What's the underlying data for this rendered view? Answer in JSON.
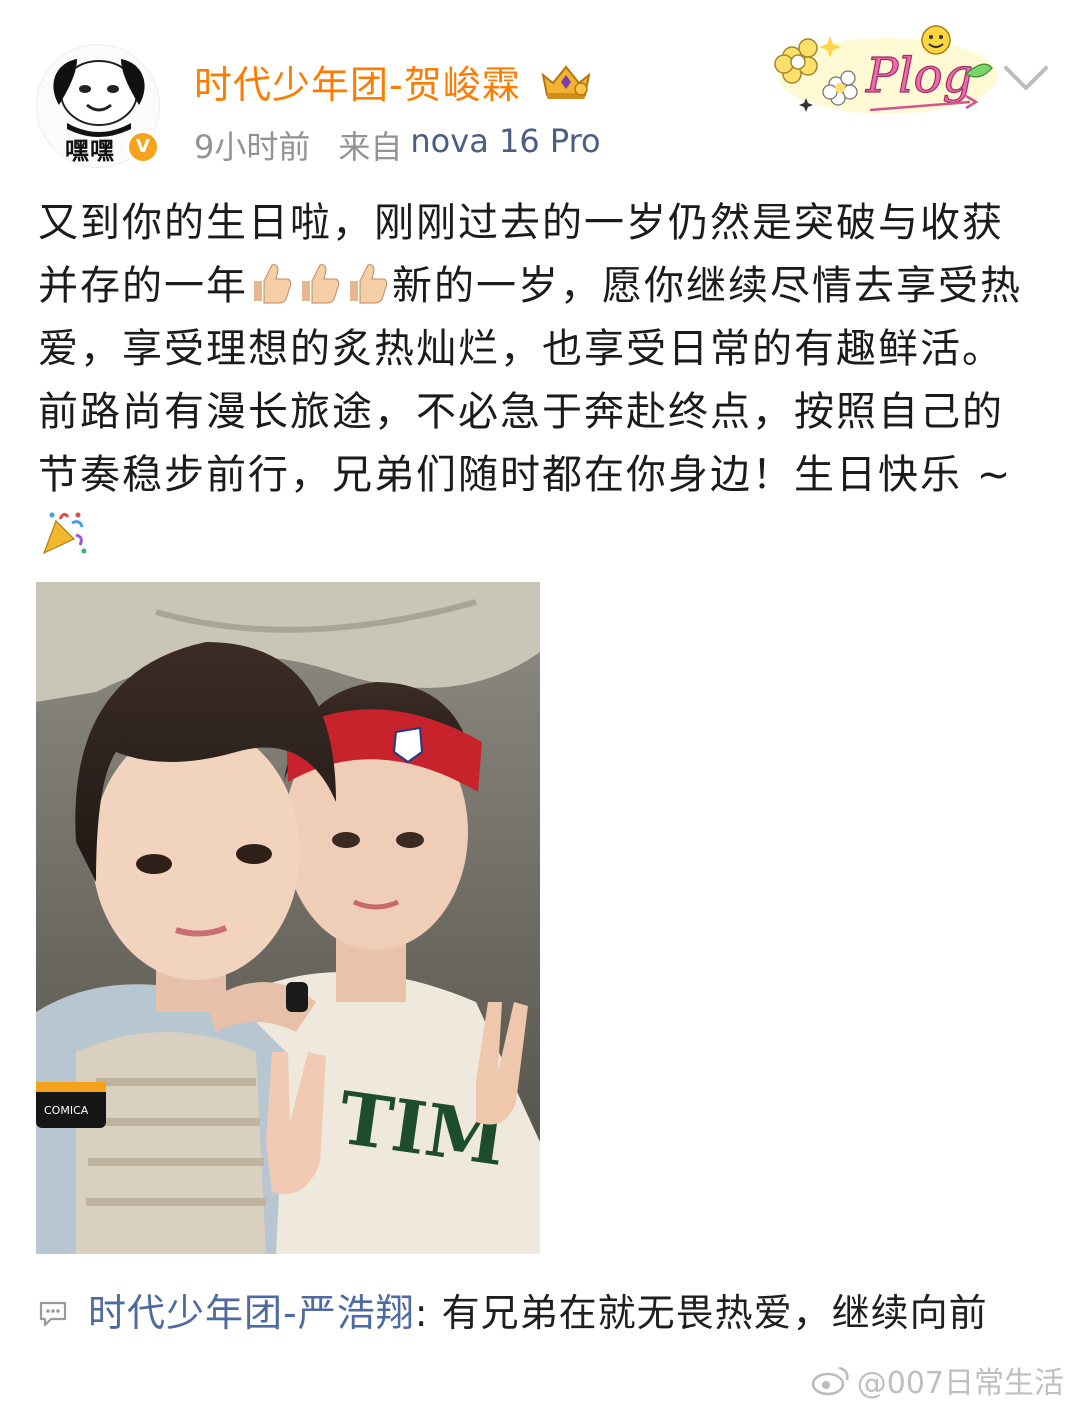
{
  "post": {
    "author": {
      "name": "时代少年团-贺峻霖",
      "avatar_caption": "嘿嘿",
      "verified_badge": "V"
    },
    "time": "9小时前",
    "source_prefix": "来自",
    "source_device": "nova 16 Pro",
    "sticker_text": "Plog",
    "text_segments": [
      "又到你的生日啦，刚刚过去的一岁仍然是突破与收获并存的一年",
      "新的一岁，愿你继续尽情去享受热爱，享受理想的炙热灿烂，也享受日常的有趣鲜活。前路尚有漫长旅途，不必急于奔赴终点，按照自己的节奏稳步前行，兄弟们随时都在你身边！生日快乐 ~ "
    ],
    "photo_texts": {
      "mic_label": "COMICA",
      "shirt_text": "TIM"
    }
  },
  "comment": {
    "author": "时代少年团-严浩翔",
    "separator": ": ",
    "text": "有兄弟在就无畏热爱，继续向前"
  },
  "watermark": {
    "text": "@007日常生活"
  },
  "colors": {
    "username": "#ff7b00",
    "meta": "#939393",
    "device": "#4b5f82",
    "comment_author": "#4f6aa1",
    "badge": "#f7a21b"
  },
  "icons": {
    "thumbs_up": "thumbs-up-emoji",
    "celebration": "party-popper-emoji",
    "comment": "comment-bubble-icon",
    "chevron": "chevron-down-icon",
    "vip": "crown-icon"
  }
}
